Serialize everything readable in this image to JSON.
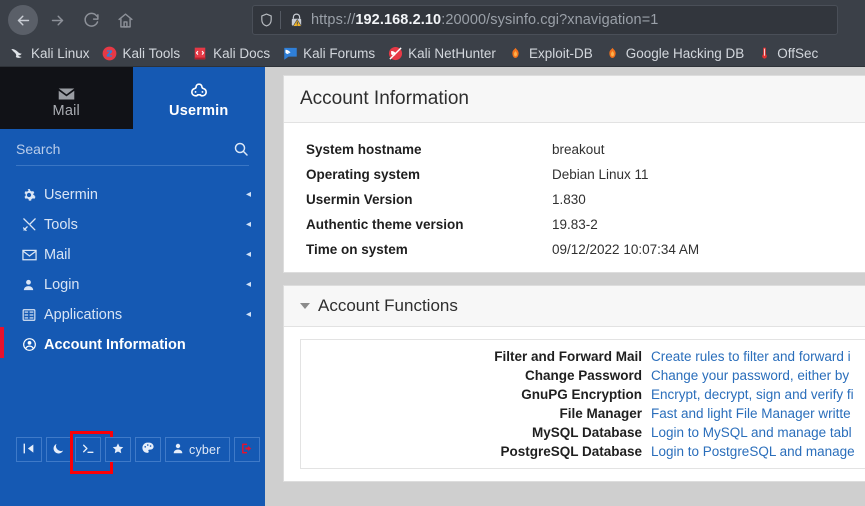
{
  "browser": {
    "nav": {
      "back": "back-arrow",
      "forward": "forward-arrow",
      "reload": "reload",
      "home": "home"
    },
    "url": {
      "scheme": "https://",
      "host": "192.168.2.10",
      "rest": ":20000/sysinfo.cgi?xnavigation=1",
      "full": "https://192.168.2.10:20000/sysinfo.cgi?xnavigation=1",
      "shield_icon": "shield-icon",
      "security_icon": "lock-warning-icon"
    },
    "bookmarks": [
      {
        "label": "Kali Linux",
        "icon": "kali-dragon-icon"
      },
      {
        "label": "Kali Tools",
        "icon": "kali-tools-icon"
      },
      {
        "label": "Kali Docs",
        "icon": "kali-docs-icon"
      },
      {
        "label": "Kali Forums",
        "icon": "kali-forums-icon"
      },
      {
        "label": "Kali NetHunter",
        "icon": "kali-nethunter-icon"
      },
      {
        "label": "Exploit-DB",
        "icon": "exploitdb-icon"
      },
      {
        "label": "Google Hacking DB",
        "icon": "google-hacking-db-icon"
      },
      {
        "label": "OffSec",
        "icon": "offsec-icon"
      }
    ]
  },
  "sidebar": {
    "tabs": [
      {
        "label": "Mail",
        "icon": "envelope-icon",
        "active": false
      },
      {
        "label": "Usermin",
        "icon": "usermin-logo-icon",
        "active": true
      }
    ],
    "search": {
      "placeholder": "Search",
      "value": "",
      "icon": "search-icon"
    },
    "items": [
      {
        "label": "Usermin",
        "icon": "gear-icon",
        "caret": "◂",
        "current": false
      },
      {
        "label": "Tools",
        "icon": "tools-icon",
        "caret": "◂",
        "current": false
      },
      {
        "label": "Mail",
        "icon": "envelope-icon",
        "caret": "◂",
        "current": false
      },
      {
        "label": "Login",
        "icon": "user-icon",
        "caret": "◂",
        "current": false
      },
      {
        "label": "Applications",
        "icon": "applications-grid-icon",
        "caret": "◂",
        "current": false
      },
      {
        "label": "Account Information",
        "icon": "account-circle-icon",
        "caret": "",
        "current": true
      }
    ],
    "buttons": [
      {
        "name": "collapse-sidebar-button",
        "icon": "collapse-panel-icon",
        "label": "",
        "highlighted": false
      },
      {
        "name": "night-mode-button",
        "icon": "moon-icon",
        "label": "",
        "highlighted": false
      },
      {
        "name": "terminal-button",
        "icon": "terminal-prompt-icon",
        "label": "",
        "highlighted": true
      },
      {
        "name": "favorites-button",
        "icon": "star-icon",
        "label": "",
        "highlighted": false
      },
      {
        "name": "theme-palette-button",
        "icon": "palette-icon",
        "label": "",
        "highlighted": false
      },
      {
        "name": "current-user-button",
        "icon": "user-icon",
        "label": "cyber",
        "highlighted": false
      },
      {
        "name": "logout-button",
        "icon": "logout-icon",
        "label": "",
        "highlighted": false
      }
    ],
    "accent_color": "#1559b3",
    "highlight_color": "#fb0007"
  },
  "main": {
    "account_information": {
      "title": "Account Information",
      "rows": [
        {
          "key": "System hostname",
          "value": "breakout"
        },
        {
          "key": "Operating system",
          "value": "Debian Linux 11"
        },
        {
          "key": "Usermin Version",
          "value": "1.830"
        },
        {
          "key": "Authentic theme version",
          "value": "19.83-2"
        },
        {
          "key": "Time on system",
          "value": "09/12/2022 10:07:34 AM"
        }
      ]
    },
    "account_functions": {
      "title": "Account Functions",
      "rows": [
        {
          "name": "Filter and Forward Mail",
          "desc": "Create rules to filter and forward i"
        },
        {
          "name": "Change Password",
          "desc": "Change your password, either by "
        },
        {
          "name": "GnuPG Encryption",
          "desc": "Encrypt, decrypt, sign and verify fi"
        },
        {
          "name": "File Manager",
          "desc": "Fast and light File Manager writte"
        },
        {
          "name": "MySQL Database",
          "desc": "Login to MySQL and manage tabl"
        },
        {
          "name": "PostgreSQL Database",
          "desc": "Login to PostgreSQL and manage"
        }
      ]
    },
    "link_color": "#2a6ebb"
  }
}
